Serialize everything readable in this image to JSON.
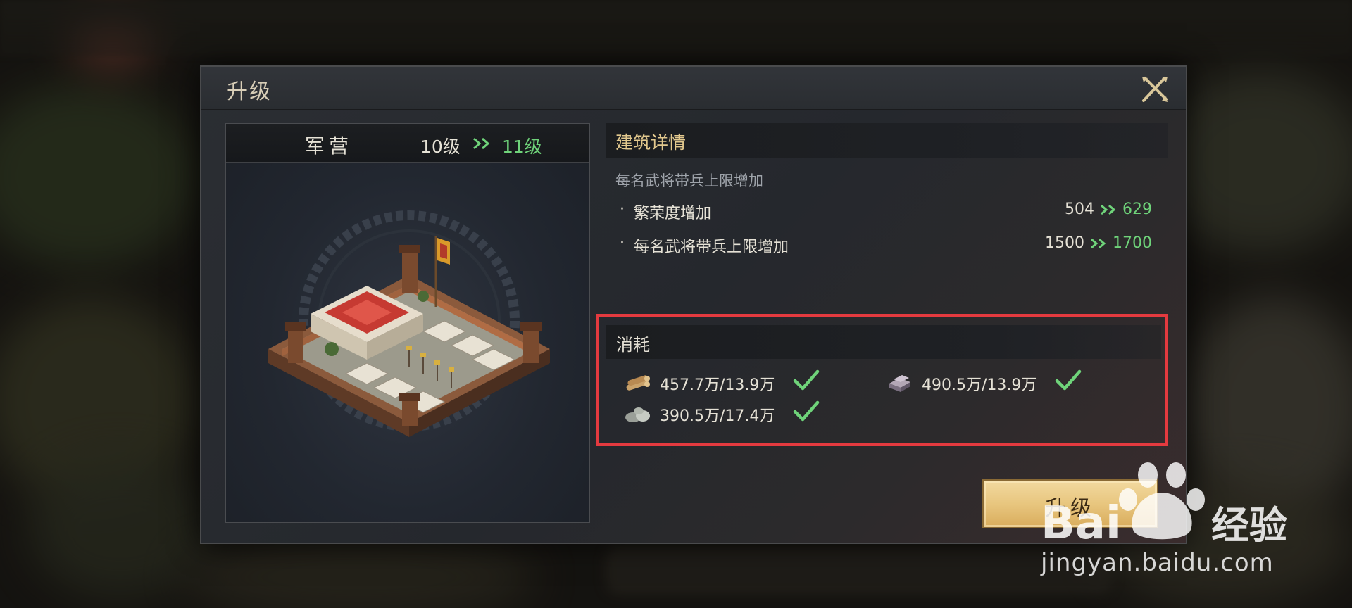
{
  "dialog": {
    "title": "升级",
    "building": {
      "name": "军营",
      "level_from": "10级",
      "level_to": "11级"
    },
    "details": {
      "title": "建筑详情",
      "subtitle": "每名武将带兵上限增加",
      "stats": [
        {
          "label": "繁荣度增加",
          "from": "504",
          "to": "629"
        },
        {
          "label": "每名武将带兵上限增加",
          "from": "1500",
          "to": "1700"
        }
      ]
    },
    "cost": {
      "title": "消耗",
      "items": [
        {
          "icon": "wood-icon",
          "amount": "457.7万/13.9万",
          "satisfied": true
        },
        {
          "icon": "iron-icon",
          "amount": "490.5万/13.9万",
          "satisfied": true
        },
        {
          "icon": "stone-icon",
          "amount": "390.5万/17.4万",
          "satisfied": true
        }
      ]
    },
    "upgrade_button": "升级"
  },
  "watermark": {
    "brand": "Baidu经验",
    "url": "jingyan.baidu.com"
  },
  "colors": {
    "accent_green": "#6fd37a",
    "gold_title": "#e3c98e",
    "highlight_red": "#e43a3f",
    "button_gold": "#e8c67f"
  }
}
